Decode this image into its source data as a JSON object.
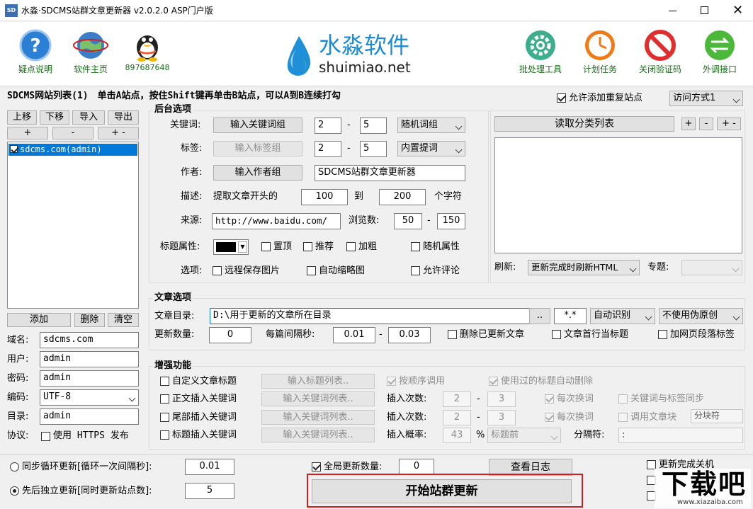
{
  "window": {
    "title": "水淼·SDCMS站群文章更新器 v2.0.2.0 ASP门户版",
    "app_icon": "SD"
  },
  "toolbar_left": [
    {
      "label": "疑点说明",
      "icon": "help-icon"
    },
    {
      "label": "软件主页",
      "icon": "globe-icon"
    },
    {
      "label": "897687648",
      "icon": "qq-penguin-icon"
    }
  ],
  "logo": {
    "cn": "水淼软件",
    "en": "shuimiao.net"
  },
  "toolbar_right": [
    {
      "label": "批处理工具",
      "icon": "gear-icon"
    },
    {
      "label": "计划任务",
      "icon": "clock-icon"
    },
    {
      "label": "关闭验证码",
      "icon": "forbidden-icon"
    },
    {
      "label": "外调接口",
      "icon": "swap-arrows-icon"
    }
  ],
  "site_list": {
    "heading": "SDCMS网站列表(1)　单击A站点，按住Shift键再单击B站点，可以A到B连续打勾",
    "allow_duplicate_label": "允许添加重复站点",
    "access_mode": "访问方式1",
    "btn_up": "上移",
    "btn_down": "下移",
    "btn_import": "导入",
    "btn_export": "导出",
    "btn_plus": "+",
    "btn_minus": "-",
    "btn_plusminus": "+ -",
    "items": [
      "sdcms.com(admin)"
    ],
    "btn_add": "添加",
    "btn_delete": "删除",
    "btn_clear": "清空"
  },
  "site_form": {
    "domain_label": "域名:",
    "domain": "sdcms.com",
    "user_label": "用户:",
    "user": "admin",
    "password_label": "密码:",
    "password": "admin",
    "encoding_label": "编码:",
    "encoding": "UTF-8",
    "dir_label": "目录:",
    "dir": "admin",
    "protocol_label": "协议:",
    "https_label": "使用 HTTPS 发布"
  },
  "backend": {
    "title": "后台选项",
    "keyword_label": "关键词:",
    "keyword_btn": "输入关键词组",
    "kw_min": "2",
    "kw_max": "5",
    "kw_mode": "随机词组",
    "tag_label": "标签:",
    "tag_btn": "输入标签组",
    "tag_min": "2",
    "tag_max": "5",
    "tag_mode": "内置提词",
    "author_label": "作者:",
    "author_btn": "输入作者组",
    "author_value": "SDCMS站群文章更新器",
    "desc_label": "描述:",
    "desc_prefix": "提取文章开头的",
    "desc_min": "100",
    "desc_to": "到",
    "desc_max": "200",
    "desc_suffix": "个字符",
    "source_label": "来源:",
    "source_value": "http://www.baidu.com/",
    "views_label": "浏览数:",
    "views_min": "50",
    "views_max": "150",
    "title_attr_label": "标题属性:",
    "color": "#000000",
    "attr_top": "置顶",
    "attr_recommend": "推荐",
    "attr_bold": "加粗",
    "attr_random": "随机属性",
    "options_label": "选项:",
    "opt_remote_img": "远程保存图片",
    "opt_thumb": "自动缩略图",
    "opt_comment": "允许评论",
    "dash": "-"
  },
  "category": {
    "read_btn": "读取分类列表",
    "btn_plus": "+",
    "btn_minus": "-",
    "btn_plusminus": "+ -",
    "refresh_label": "刷新:",
    "refresh_value": "更新完成时刷新HTML",
    "topic_label": "专题:",
    "topic_value": ""
  },
  "article": {
    "title": "文章选项",
    "dir_label": "文章目录:",
    "dir_value": "D:\\用于更新的文章所在目录",
    "browse": "..",
    "ext": "*.*",
    "detect": "自动识别",
    "pseudo": "不使用伪原创",
    "count_label": "更新数量:",
    "count": "0",
    "interval_label": "每篇间隔秒:",
    "interval_min": "0.01",
    "interval_max": "0.03",
    "del_updated": "删除已更新文章",
    "first_line_title": "文章首行当标题",
    "add_para_tag": "加网页段落标签"
  },
  "enhance": {
    "title": "增强功能",
    "custom_title": "自定义文章标题",
    "custom_title_btn": "输入标题列表..",
    "seq_call": "按顺序调用",
    "auto_del_used": "使用过的标题自动删除",
    "body_kw": "正文插入关键词",
    "body_kw_btn": "输入关键词列表..",
    "body_times_label": "插入次数:",
    "body_min": "2",
    "body_max": "3",
    "body_each": "每次换词",
    "kw_tag_sync": "关键词与标签同步",
    "tail_kw": "尾部插入关键词",
    "tail_kw_btn": "输入关键词列表..",
    "tail_times_label": "插入次数:",
    "tail_min": "2",
    "tail_max": "3",
    "tail_each": "每次换词",
    "call_block": "调用文章块",
    "block_sep": "分块符",
    "title_kw": "标题插入关键词",
    "title_kw_btn": "输入关键词列表..",
    "prob_label": "插入概率:",
    "prob": "43",
    "percent": "%",
    "position": "标题前",
    "sep_label": "分隔符:",
    "sep_value": ":"
  },
  "bottom": {
    "sync_loop": "同步循环更新[循环一次间隔秒]:",
    "sync_value": "0.01",
    "seq_update": "先后独立更新[同时更新站点数]:",
    "seq_value": "5",
    "global_count": "全局更新数量:",
    "global_value": "0",
    "view_log": "查看日志",
    "start": "开始站群更新",
    "shutdown": "更新完成关机"
  },
  "watermark": {
    "cn": "下载吧",
    "en": "www.xiazaiba.com"
  }
}
